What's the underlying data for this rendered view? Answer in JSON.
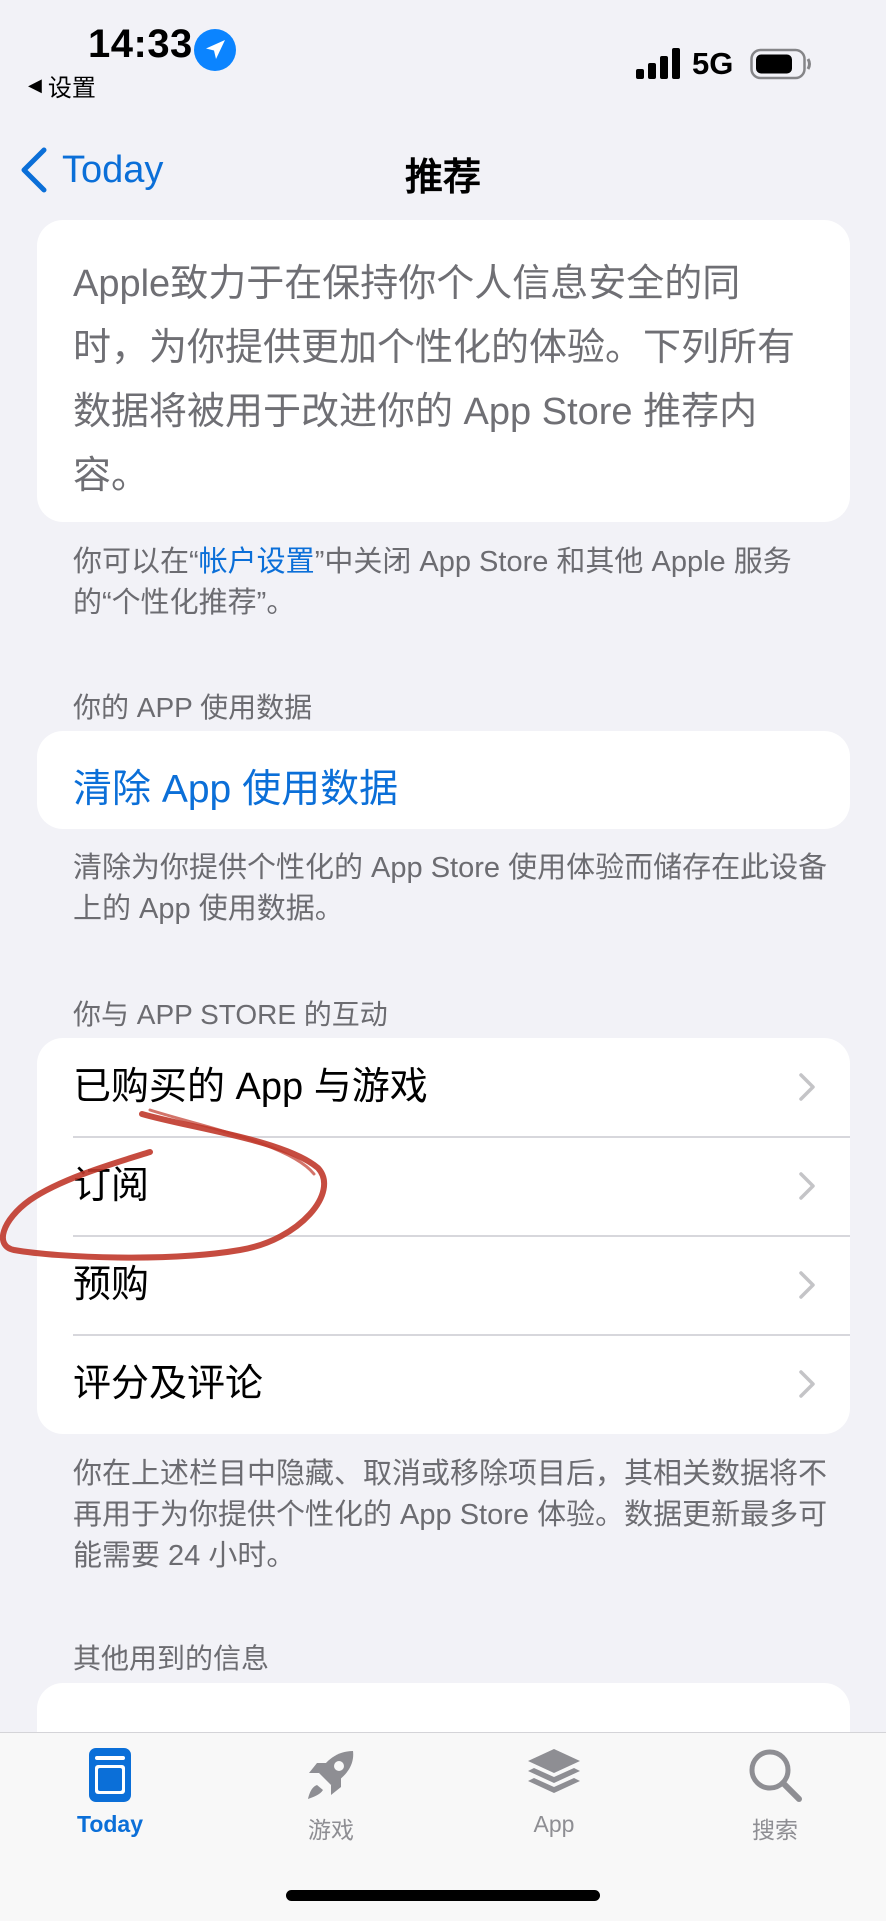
{
  "status_bar": {
    "time": "14:33",
    "back_app": "设置",
    "network": "5G",
    "icons": [
      "location-arrow-icon",
      "signal-bars-icon",
      "battery-icon"
    ]
  },
  "nav": {
    "back_label": "Today",
    "title": "推荐"
  },
  "intro": {
    "text": "Apple致力于在保持你个人信息安全的同时，为你提供更加个性化的体验。下列所有数据将被用于改进你的 App Store 推荐内容。",
    "note_before": "你可以在“",
    "note_link": "帐户设置",
    "note_after": "”中关闭 App Store 和其他 Apple 服务的“个性化推荐”。"
  },
  "usage_section": {
    "header": "你的 APP 使用数据",
    "clear_label": "清除 App 使用数据",
    "note": "清除为你提供个性化的 App Store 使用体验而储存在此设备上的 App 使用数据。"
  },
  "interaction_section": {
    "header": "你与 APP STORE 的互动",
    "rows": [
      {
        "label": "已购买的 App 与游戏"
      },
      {
        "label": "订阅"
      },
      {
        "label": "预购"
      },
      {
        "label": "评分及评论"
      }
    ],
    "note": "你在上述栏目中隐藏、取消或移除项目后，其相关数据将不再用于为你提供个性化的 App Store 体验。数据更新最多可能需要 24 小时。"
  },
  "other_section": {
    "header": "其他用到的信息"
  },
  "tabs": [
    {
      "label": "Today",
      "icon": "today-icon",
      "active": true
    },
    {
      "label": "游戏",
      "icon": "rocket-icon",
      "active": false
    },
    {
      "label": "App",
      "icon": "app-stack-icon",
      "active": false
    },
    {
      "label": "搜索",
      "icon": "search-icon",
      "active": false
    }
  ],
  "colors": {
    "accent": "#0b6fd8",
    "background": "#f2f2f7",
    "secondary_text": "#6c6c71",
    "annotation": "#c0392b"
  }
}
